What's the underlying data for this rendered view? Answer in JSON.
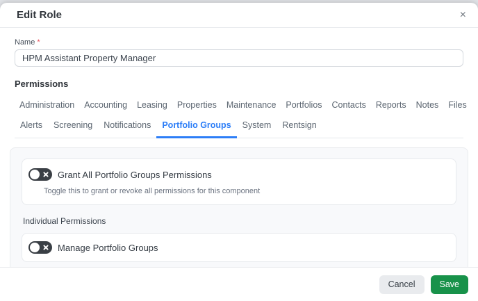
{
  "modal": {
    "title": "Edit Role",
    "close_icon": "×"
  },
  "form": {
    "name_label": "Name",
    "required_marker": "*",
    "name_value": "HPM Assistant Property Manager"
  },
  "permissions": {
    "heading": "Permissions",
    "tabs_row1": [
      "Administration",
      "Accounting",
      "Leasing",
      "Properties",
      "Maintenance",
      "Portfolios",
      "Contacts",
      "Reports",
      "Notes",
      "Files"
    ],
    "tabs_row2": [
      "Alerts",
      "Screening",
      "Notifications",
      "Portfolio Groups",
      "System",
      "Rentsign"
    ],
    "active_tab": "Portfolio Groups",
    "panel": {
      "grant_all": {
        "label": "Grant All Portfolio Groups Permissions",
        "help_text": "Toggle this to grant or revoke all permissions for this component",
        "state": "off"
      },
      "individual_heading": "Individual Permissions",
      "items": [
        {
          "label": "Manage Portfolio Groups",
          "state": "off"
        }
      ]
    }
  },
  "footer": {
    "cancel_label": "Cancel",
    "save_label": "Save"
  },
  "colors": {
    "accent_blue": "#2d7ef7",
    "save_green": "#18924a",
    "toggle_off_bg": "#3a3f45",
    "asterisk_red": "#e8505b"
  }
}
